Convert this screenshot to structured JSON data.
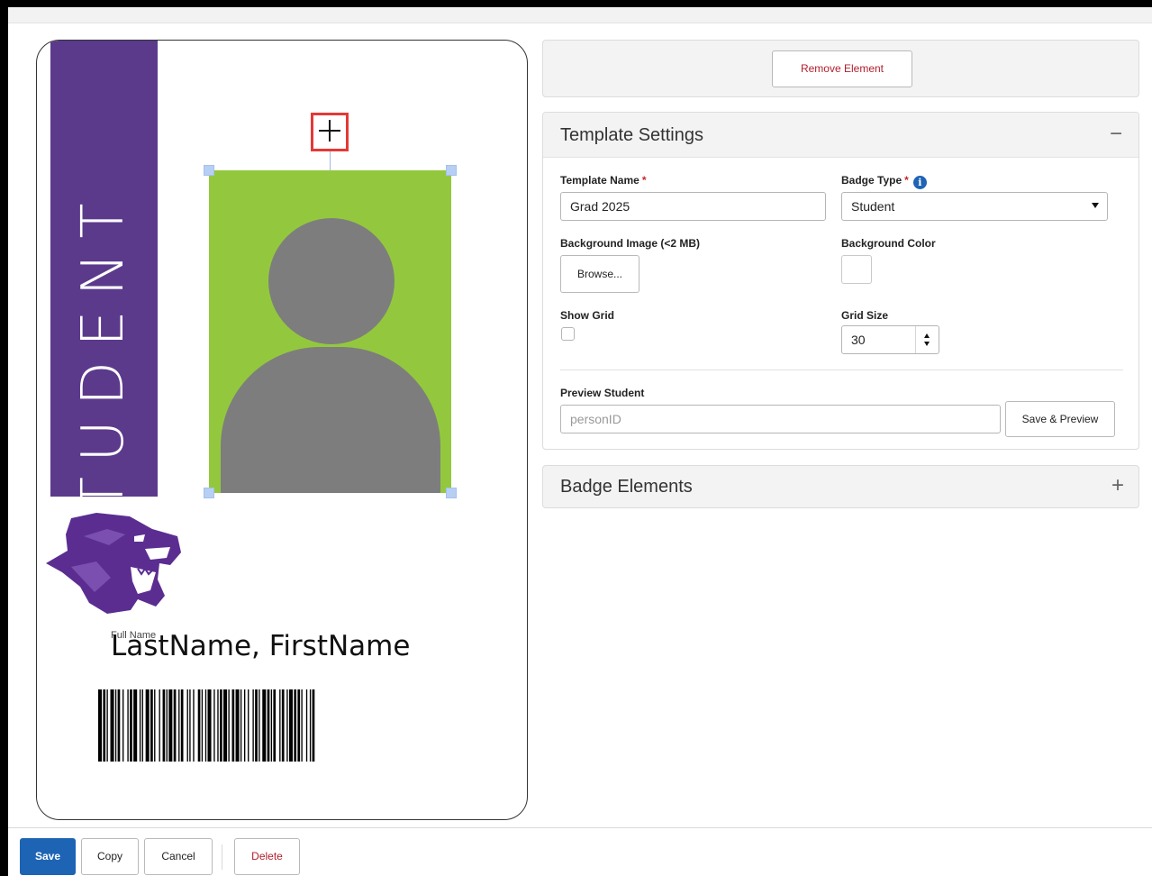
{
  "badge": {
    "band_text": "STUDENT",
    "full_name_label": "Full Name",
    "full_name_value": "LastName, FirstName",
    "band_color": "#5b3a8c",
    "photo_bg_color": "#93c83e",
    "silhouette_color": "#7d7d7d"
  },
  "actions": {
    "remove_element_label": "Remove Element"
  },
  "template_settings": {
    "title": "Template Settings",
    "collapse_icon": "−",
    "template_name_label": "Template Name",
    "template_name_value": "Grad 2025",
    "badge_type_label": "Badge Type",
    "badge_type_value": "Student",
    "info_icon": "i",
    "required_marker": "*",
    "background_image_label": "Background Image (<2 MB)",
    "browse_label": "Browse...",
    "background_color_label": "Background Color",
    "show_grid_label": "Show Grid",
    "show_grid_checked": false,
    "grid_size_label": "Grid Size",
    "grid_size_value": "30",
    "preview_student_label": "Preview Student",
    "preview_placeholder": "personID",
    "save_preview_label": "Save & Preview"
  },
  "badge_elements": {
    "title": "Badge Elements",
    "expand_icon": "+"
  },
  "bottom_bar": {
    "save_label": "Save",
    "copy_label": "Copy",
    "cancel_label": "Cancel",
    "delete_label": "Delete"
  },
  "colors": {
    "primary_button": "#1e64b4",
    "danger_text": "#b0202e",
    "selection_highlight": "#e53935"
  }
}
